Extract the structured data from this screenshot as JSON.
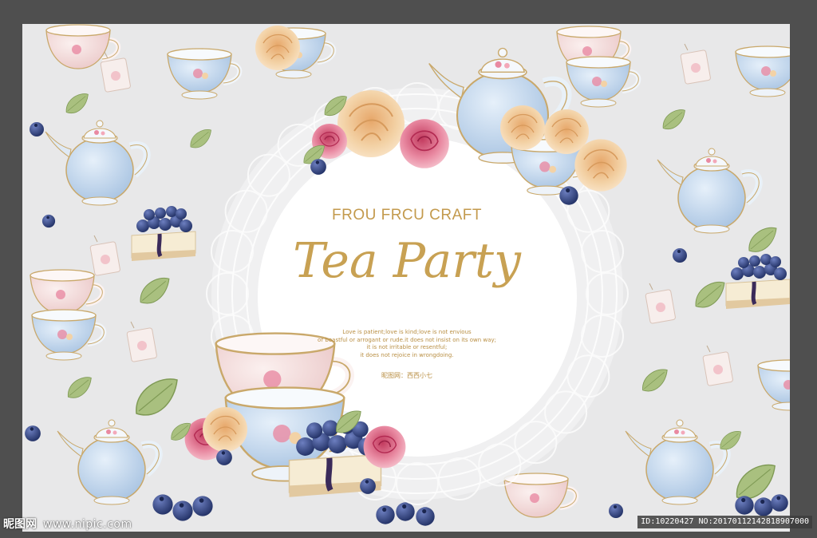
{
  "poster": {
    "brand": "FROU FRCU CRAFT",
    "title": "Tea Party",
    "quote_lines": [
      "Love is patient;love is kind;love is not envious",
      "or boastful or arrogant or rude.it does not insist on its own way;",
      "it is not irritable or resentful;",
      "it does not rejoice in wrongdoing."
    ],
    "credit": "昵图网：西西小七"
  },
  "watermark": {
    "logo_text": "昵图网",
    "site": "www.nipic.com",
    "id_text": "ID:10220427 NO:20170112142818907000"
  },
  "colors": {
    "workspace": "#4f4f4f",
    "artboard": "#e8e8e9",
    "gold_text": "#c39a4d",
    "porcelain_blue": "#bcd3ea",
    "porcelain_pink": "#f2d8d8",
    "blueberry": "#3a4f8c",
    "leaf": "#9fb87a",
    "rose": "#e98aa2",
    "peony": "#f3d2a6"
  },
  "decor_icons": [
    "teapot-icon",
    "teacup-icon",
    "tea-bag-icon",
    "leaf-icon",
    "blueberry-icon",
    "cheesecake-icon",
    "rose-icon",
    "peony-icon",
    "lace-doily"
  ]
}
